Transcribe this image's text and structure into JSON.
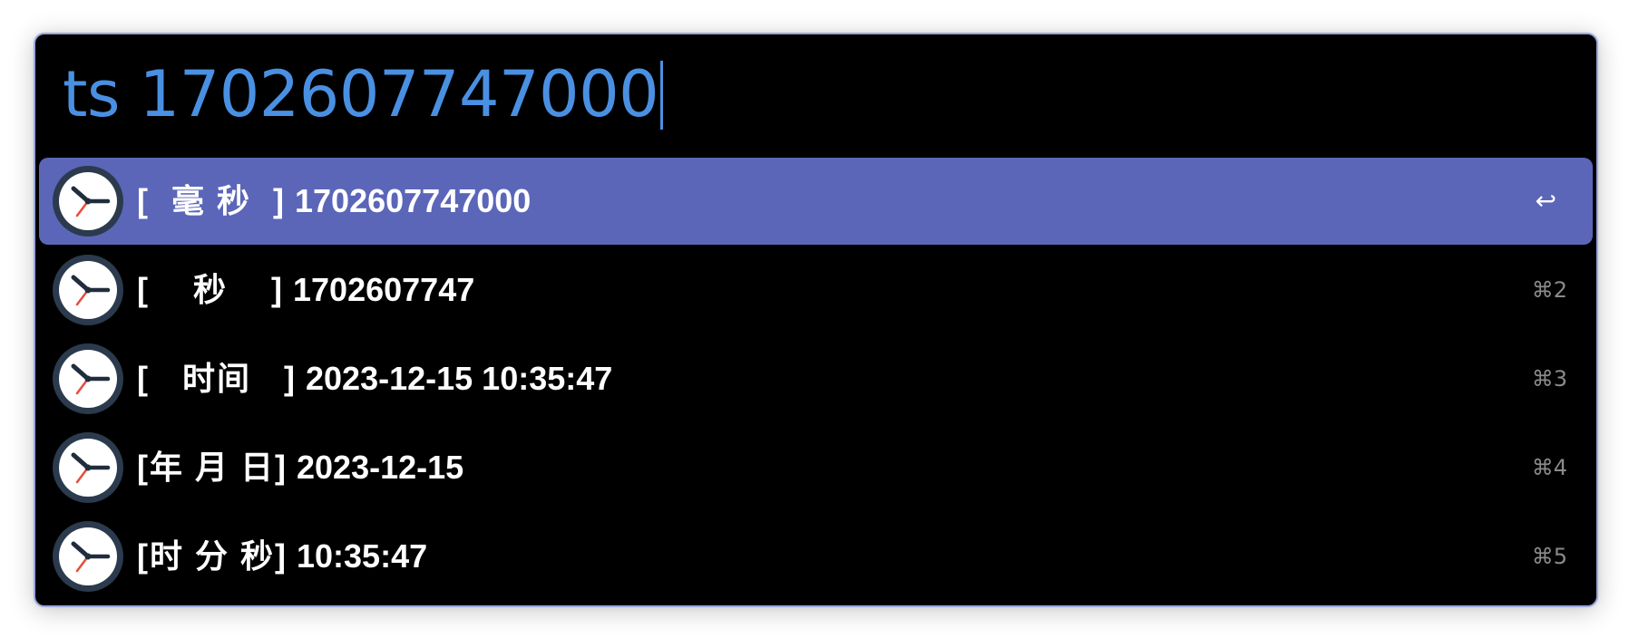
{
  "query": {
    "text": "ts 1702607747000"
  },
  "results": [
    {
      "tag": "[  毫 秒  ]",
      "value": "1702607747000",
      "shortcut": "↩",
      "selected": true
    },
    {
      "tag": "[    秒    ]",
      "value": "1702607747",
      "shortcut": "⌘2",
      "selected": false
    },
    {
      "tag": "[   时间   ]",
      "value": "2023-12-15 10:35:47",
      "shortcut": "⌘3",
      "selected": false
    },
    {
      "tag": "[年 月 日]",
      "value": "2023-12-15",
      "shortcut": "⌘4",
      "selected": false
    },
    {
      "tag": "[时 分 秒]",
      "value": "10:35:47",
      "shortcut": "⌘5",
      "selected": false
    }
  ],
  "icon": "clock-icon",
  "colors": {
    "query": "#4a90e2",
    "selected_row": "#5b66b9",
    "background": "#000000",
    "shortcut": "#8a8a8a"
  }
}
